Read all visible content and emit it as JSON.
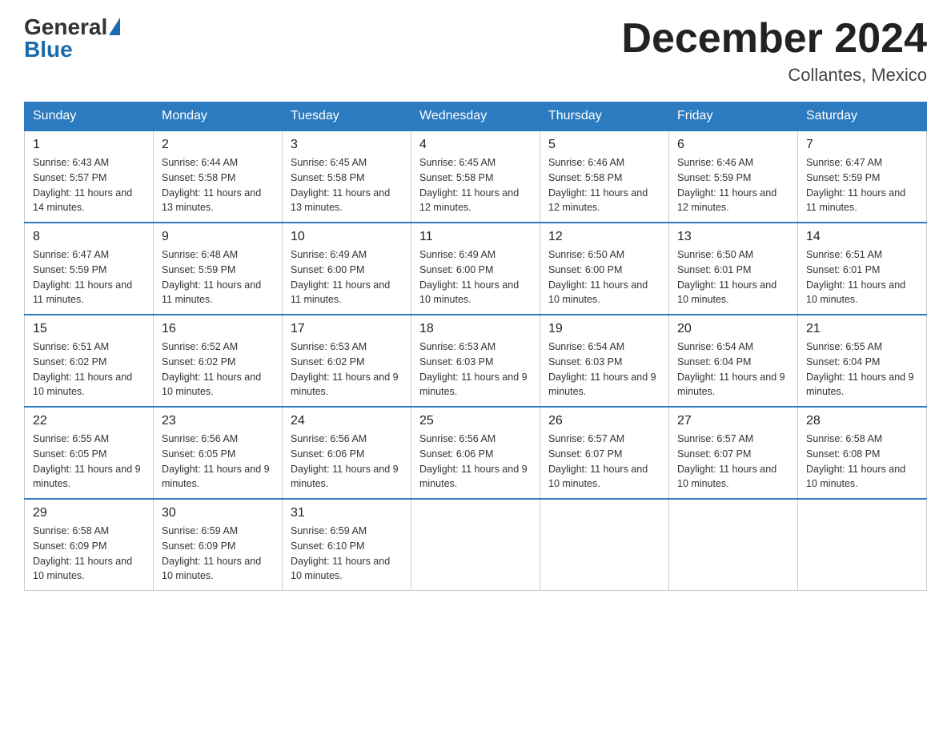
{
  "header": {
    "logo_general": "General",
    "logo_blue": "Blue",
    "month_year": "December 2024",
    "location": "Collantes, Mexico"
  },
  "days_of_week": [
    "Sunday",
    "Monday",
    "Tuesday",
    "Wednesday",
    "Thursday",
    "Friday",
    "Saturday"
  ],
  "weeks": [
    [
      {
        "day": "1",
        "sunrise": "6:43 AM",
        "sunset": "5:57 PM",
        "daylight": "11 hours and 14 minutes."
      },
      {
        "day": "2",
        "sunrise": "6:44 AM",
        "sunset": "5:58 PM",
        "daylight": "11 hours and 13 minutes."
      },
      {
        "day": "3",
        "sunrise": "6:45 AM",
        "sunset": "5:58 PM",
        "daylight": "11 hours and 13 minutes."
      },
      {
        "day": "4",
        "sunrise": "6:45 AM",
        "sunset": "5:58 PM",
        "daylight": "11 hours and 12 minutes."
      },
      {
        "day": "5",
        "sunrise": "6:46 AM",
        "sunset": "5:58 PM",
        "daylight": "11 hours and 12 minutes."
      },
      {
        "day": "6",
        "sunrise": "6:46 AM",
        "sunset": "5:59 PM",
        "daylight": "11 hours and 12 minutes."
      },
      {
        "day": "7",
        "sunrise": "6:47 AM",
        "sunset": "5:59 PM",
        "daylight": "11 hours and 11 minutes."
      }
    ],
    [
      {
        "day": "8",
        "sunrise": "6:47 AM",
        "sunset": "5:59 PM",
        "daylight": "11 hours and 11 minutes."
      },
      {
        "day": "9",
        "sunrise": "6:48 AM",
        "sunset": "5:59 PM",
        "daylight": "11 hours and 11 minutes."
      },
      {
        "day": "10",
        "sunrise": "6:49 AM",
        "sunset": "6:00 PM",
        "daylight": "11 hours and 11 minutes."
      },
      {
        "day": "11",
        "sunrise": "6:49 AM",
        "sunset": "6:00 PM",
        "daylight": "11 hours and 10 minutes."
      },
      {
        "day": "12",
        "sunrise": "6:50 AM",
        "sunset": "6:00 PM",
        "daylight": "11 hours and 10 minutes."
      },
      {
        "day": "13",
        "sunrise": "6:50 AM",
        "sunset": "6:01 PM",
        "daylight": "11 hours and 10 minutes."
      },
      {
        "day": "14",
        "sunrise": "6:51 AM",
        "sunset": "6:01 PM",
        "daylight": "11 hours and 10 minutes."
      }
    ],
    [
      {
        "day": "15",
        "sunrise": "6:51 AM",
        "sunset": "6:02 PM",
        "daylight": "11 hours and 10 minutes."
      },
      {
        "day": "16",
        "sunrise": "6:52 AM",
        "sunset": "6:02 PM",
        "daylight": "11 hours and 10 minutes."
      },
      {
        "day": "17",
        "sunrise": "6:53 AM",
        "sunset": "6:02 PM",
        "daylight": "11 hours and 9 minutes."
      },
      {
        "day": "18",
        "sunrise": "6:53 AM",
        "sunset": "6:03 PM",
        "daylight": "11 hours and 9 minutes."
      },
      {
        "day": "19",
        "sunrise": "6:54 AM",
        "sunset": "6:03 PM",
        "daylight": "11 hours and 9 minutes."
      },
      {
        "day": "20",
        "sunrise": "6:54 AM",
        "sunset": "6:04 PM",
        "daylight": "11 hours and 9 minutes."
      },
      {
        "day": "21",
        "sunrise": "6:55 AM",
        "sunset": "6:04 PM",
        "daylight": "11 hours and 9 minutes."
      }
    ],
    [
      {
        "day": "22",
        "sunrise": "6:55 AM",
        "sunset": "6:05 PM",
        "daylight": "11 hours and 9 minutes."
      },
      {
        "day": "23",
        "sunrise": "6:56 AM",
        "sunset": "6:05 PM",
        "daylight": "11 hours and 9 minutes."
      },
      {
        "day": "24",
        "sunrise": "6:56 AM",
        "sunset": "6:06 PM",
        "daylight": "11 hours and 9 minutes."
      },
      {
        "day": "25",
        "sunrise": "6:56 AM",
        "sunset": "6:06 PM",
        "daylight": "11 hours and 9 minutes."
      },
      {
        "day": "26",
        "sunrise": "6:57 AM",
        "sunset": "6:07 PM",
        "daylight": "11 hours and 10 minutes."
      },
      {
        "day": "27",
        "sunrise": "6:57 AM",
        "sunset": "6:07 PM",
        "daylight": "11 hours and 10 minutes."
      },
      {
        "day": "28",
        "sunrise": "6:58 AM",
        "sunset": "6:08 PM",
        "daylight": "11 hours and 10 minutes."
      }
    ],
    [
      {
        "day": "29",
        "sunrise": "6:58 AM",
        "sunset": "6:09 PM",
        "daylight": "11 hours and 10 minutes."
      },
      {
        "day": "30",
        "sunrise": "6:59 AM",
        "sunset": "6:09 PM",
        "daylight": "11 hours and 10 minutes."
      },
      {
        "day": "31",
        "sunrise": "6:59 AM",
        "sunset": "6:10 PM",
        "daylight": "11 hours and 10 minutes."
      },
      null,
      null,
      null,
      null
    ]
  ],
  "labels": {
    "sunrise": "Sunrise:",
    "sunset": "Sunset:",
    "daylight": "Daylight:"
  }
}
